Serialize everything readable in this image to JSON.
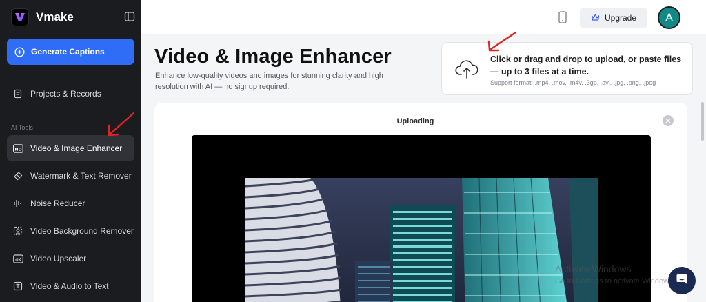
{
  "brand": {
    "name": "Vmake"
  },
  "sidebar": {
    "generate_label": "Generate Captions",
    "projects_label": "Projects & Records",
    "section_label": "AI Tools",
    "tools": [
      {
        "label": "Video & Image Enhancer",
        "icon": "hd-icon",
        "active": true
      },
      {
        "label": "Watermark & Text Remover",
        "icon": "eraser-icon"
      },
      {
        "label": "Noise Reducer",
        "icon": "noise-icon"
      },
      {
        "label": "Video Background Remover",
        "icon": "background-remove-icon"
      },
      {
        "label": "Video Upscaler",
        "icon": "4k-icon"
      },
      {
        "label": "Video & Audio to Text",
        "icon": "text-icon"
      }
    ]
  },
  "topbar": {
    "upgrade_label": "Upgrade",
    "avatar_initial": "A"
  },
  "page": {
    "title": "Video & Image Enhancer",
    "subtitle": "Enhance low-quality videos and images for stunning clarity and high resolution with AI — no signup required."
  },
  "upload": {
    "main_text": "Click or drag and drop to upload, or paste files — up to 3 files at a time.",
    "format_text": "Support format: .mp4, .mov, .m4v, .3gp, .avi, .jpg, .png, .jpeg"
  },
  "card": {
    "status": "Uploading"
  },
  "watermark": {
    "line1": "Activate Windows",
    "line2": "Go to Settings to activate Windows."
  },
  "colors": {
    "accent": "#2f6df6",
    "sidebar_bg": "#1b1c1f",
    "avatar": "#0f8a86",
    "annotation_arrow": "#e02424"
  }
}
